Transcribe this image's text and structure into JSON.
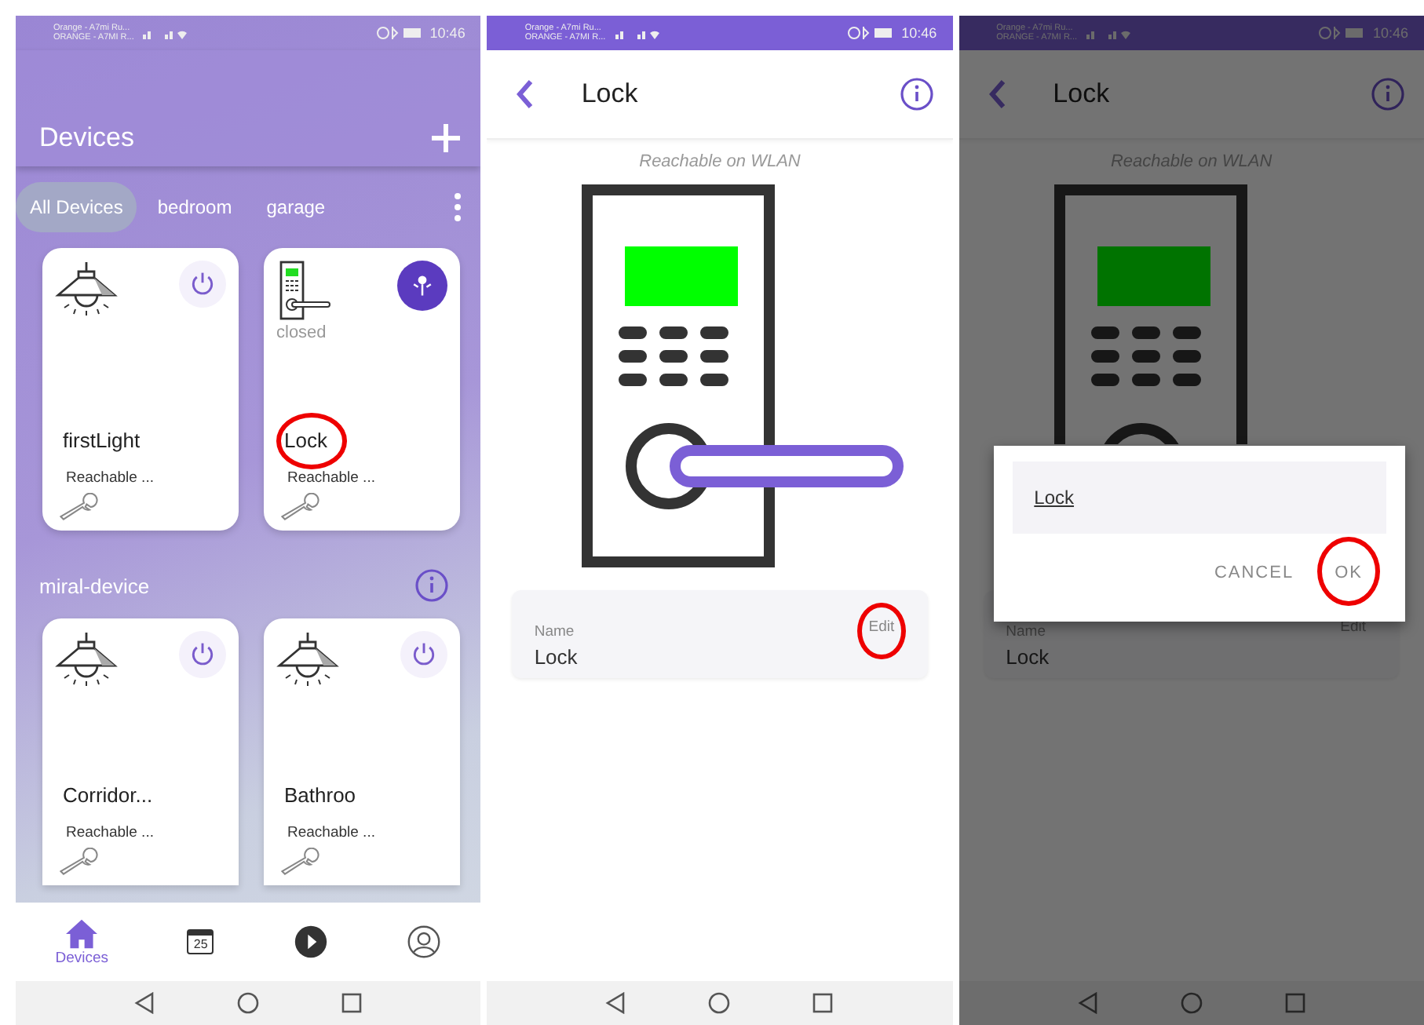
{
  "screens": [
    {
      "kind": "devices",
      "status_bar": {
        "carrier_1": "Orange - A7mi Ru...",
        "carrier_2": "ORANGE - A7MI R...",
        "time": "10:46"
      },
      "title": "Devices",
      "filters": [
        {
          "label": "All Devices",
          "selected": true
        },
        {
          "label": "bedroom",
          "selected": false
        },
        {
          "label": "garage",
          "selected": false
        }
      ],
      "devices": [
        {
          "kind": "light",
          "name": "firstLight",
          "status": "Reachable ...",
          "circled": false
        },
        {
          "kind": "lock",
          "name": "Lock",
          "caption": "closed",
          "status": "Reachable ...",
          "circled": true
        }
      ],
      "section": {
        "title": "miral-device",
        "devices": [
          {
            "kind": "light",
            "name": "Corridor...",
            "status": "Reachable ...",
            "circled": false
          },
          {
            "kind": "light",
            "name": "Bathroo",
            "status": "Reachable ...",
            "circled": false
          }
        ]
      },
      "bottom_nav": [
        {
          "kind": "home",
          "label": "Devices",
          "selected": true
        },
        {
          "kind": "calendar",
          "text": "25",
          "selected": false
        },
        {
          "kind": "play",
          "selected": false
        },
        {
          "kind": "profile",
          "selected": false
        }
      ]
    },
    {
      "kind": "detail",
      "status_bar": {
        "carrier_1": "Orange - A7mi Ru...",
        "carrier_2": "ORANGE - A7MI R...",
        "time": "10:46"
      },
      "title": "Lock",
      "subtitle": "Reachable on WLAN",
      "field": {
        "label": "Name",
        "value": "Lock",
        "action": "Edit",
        "circled": true
      }
    },
    {
      "kind": "detail",
      "status_bar": {
        "carrier_1": "Orange - A7mi Ru...",
        "carrier_2": "ORANGE - A7MI R...",
        "time": "10:46"
      },
      "title": "Lock",
      "subtitle": "Reachable on WLAN",
      "field": {
        "label": "Name",
        "value": "Lock",
        "action": "Edit",
        "circled": false
      },
      "dialog": {
        "value": "Lock",
        "buttons": [
          {
            "label": "CANCEL",
            "circled": false
          },
          {
            "label": "OK",
            "circled": true
          }
        ]
      }
    }
  ]
}
